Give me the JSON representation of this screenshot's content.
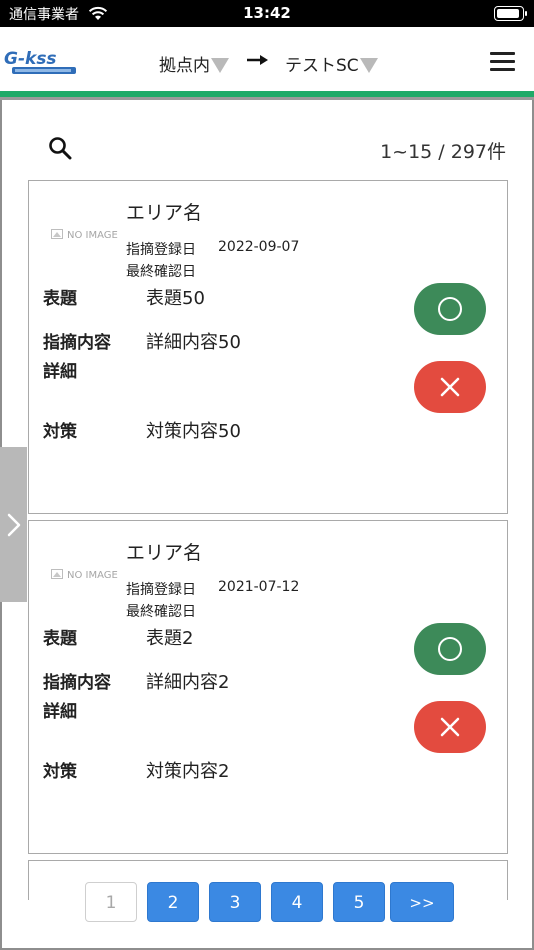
{
  "status_bar": {
    "carrier": "通信事業者",
    "time": "13:42",
    "battery_level": 0.95
  },
  "header": {
    "logo_text": "G-kss",
    "location_from": "拠点内",
    "arrow": "→",
    "location_to": "テストSC",
    "accent_color": "#1faa68"
  },
  "list": {
    "count_text": "1~15 / 297件"
  },
  "cards": [
    {
      "no_image": "NO IMAGE",
      "area": "エリア名",
      "registered_label": "指摘登録日",
      "registered_date": "2022-09-07",
      "last_check_label": "最終確認日",
      "title_label": "表題",
      "title_value": "表題50",
      "content_label": "指摘内容",
      "content_value": "詳細内容50",
      "detail_label": "詳細",
      "measure_label": "対策",
      "measure_value": "対策内容50"
    },
    {
      "no_image": "NO IMAGE",
      "area": "エリア名",
      "registered_label": "指摘登録日",
      "registered_date": "2021-07-12",
      "last_check_label": "最終確認日",
      "title_label": "表題",
      "title_value": "表題2",
      "content_label": "指摘内容",
      "content_value": "詳細内容2",
      "detail_label": "詳細",
      "measure_label": "対策",
      "measure_value": "対策内容2"
    }
  ],
  "buttons": {
    "ok_color": "#3d8a59",
    "ng_color": "#e34b3f"
  },
  "pagination": {
    "current": "1",
    "pages": [
      "1",
      "2",
      "3",
      "4",
      "5"
    ],
    "next": ">>",
    "active_color": "#3b89e3"
  }
}
